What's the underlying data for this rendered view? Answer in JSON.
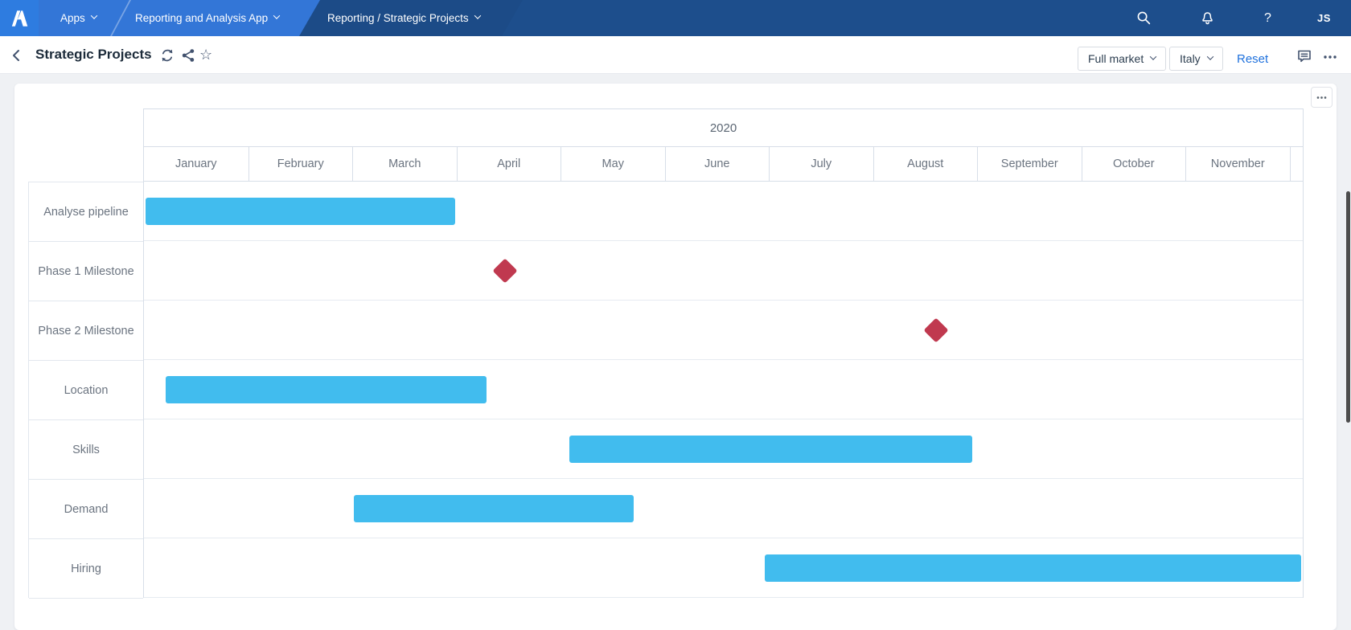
{
  "navbar": {
    "apps_label": "Apps",
    "app_name": "Reporting and Analysis App",
    "page_breadcrumb": "Reporting / Strategic Projects",
    "help_label": "?",
    "user_initials": "JS"
  },
  "header": {
    "title": "Strategic Projects",
    "star_glyph": "☆",
    "filters": [
      {
        "label": "Full market"
      },
      {
        "label": "Italy"
      }
    ],
    "reset_label": "Reset"
  },
  "colors": {
    "bar_blue": "#41bcee",
    "milestone_red": "#c0394f",
    "navbar_light_blue": "#3376d7",
    "navbar_dark_blue": "#1d4e8c",
    "link_blue": "#2072dd"
  },
  "chart_data": {
    "type": "gantt",
    "title": "Strategic Projects",
    "year": "2020",
    "months": [
      "January",
      "February",
      "March",
      "April",
      "May",
      "June",
      "July",
      "August",
      "September",
      "October",
      "November"
    ],
    "axis_range": {
      "start": "2020-01-01",
      "end": "2020-12-05"
    },
    "grid": "horizontal-rows-only",
    "rows": [
      {
        "label": "Analyse pipeline",
        "type": "bar",
        "start": "2020-01-01",
        "end": "2020-04-01"
      },
      {
        "label": "Phase 1 Milestone",
        "type": "milestone",
        "date": "2020-04-15"
      },
      {
        "label": "Phase 2 Milestone",
        "type": "milestone",
        "date": "2020-08-19"
      },
      {
        "label": "Location",
        "type": "bar",
        "start": "2020-01-07",
        "end": "2020-04-10"
      },
      {
        "label": "Skills",
        "type": "bar",
        "start": "2020-05-04",
        "end": "2020-08-30"
      },
      {
        "label": "Demand",
        "type": "bar",
        "start": "2020-03-02",
        "end": "2020-05-23"
      },
      {
        "label": "Hiring",
        "type": "bar",
        "start": "2020-06-30",
        "end": "2020-12-04"
      }
    ]
  }
}
